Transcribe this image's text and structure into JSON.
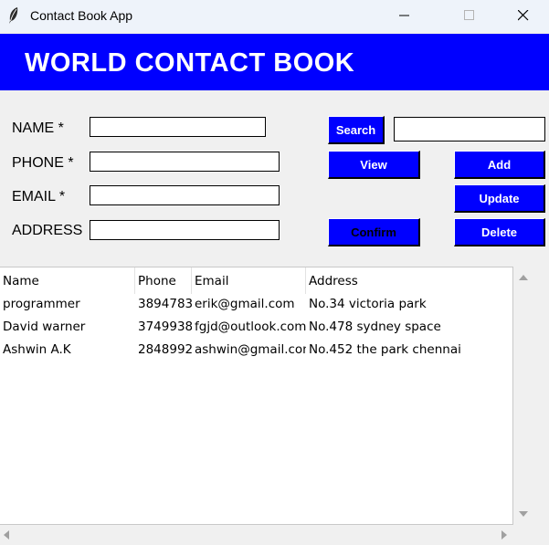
{
  "window": {
    "title": "Contact Book App",
    "controls": [
      "minimize",
      "maximize",
      "close"
    ]
  },
  "banner": {
    "title": "WORLD CONTACT BOOK"
  },
  "form": {
    "name_label": "NAME *",
    "phone_label": "PHONE *",
    "email_label": "EMAIL *",
    "address_label": "ADDRESS",
    "name_value": "",
    "phone_value": "",
    "email_value": "",
    "address_value": "",
    "search_value": ""
  },
  "buttons": {
    "search": "Search",
    "view": "View",
    "add": "Add",
    "update": "Update",
    "confirm": "Confirm",
    "delete": "Delete"
  },
  "table": {
    "columns": [
      "Name",
      "Phone",
      "Email",
      "Address"
    ],
    "rows": [
      [
        "programmer",
        "3894783",
        "erik@gmail.com",
        "No.34 victoria park"
      ],
      [
        "David warner",
        "3749938",
        "fgjd@outlook.com",
        "No.478 sydney space"
      ],
      [
        "Ashwin A.K",
        "2848992",
        "ashwin@gmail.com",
        "No.452 the park chennai"
      ]
    ]
  },
  "colors": {
    "accent": "#0000ff",
    "button_text": "#ffffff",
    "confirm_text": "#000000"
  }
}
